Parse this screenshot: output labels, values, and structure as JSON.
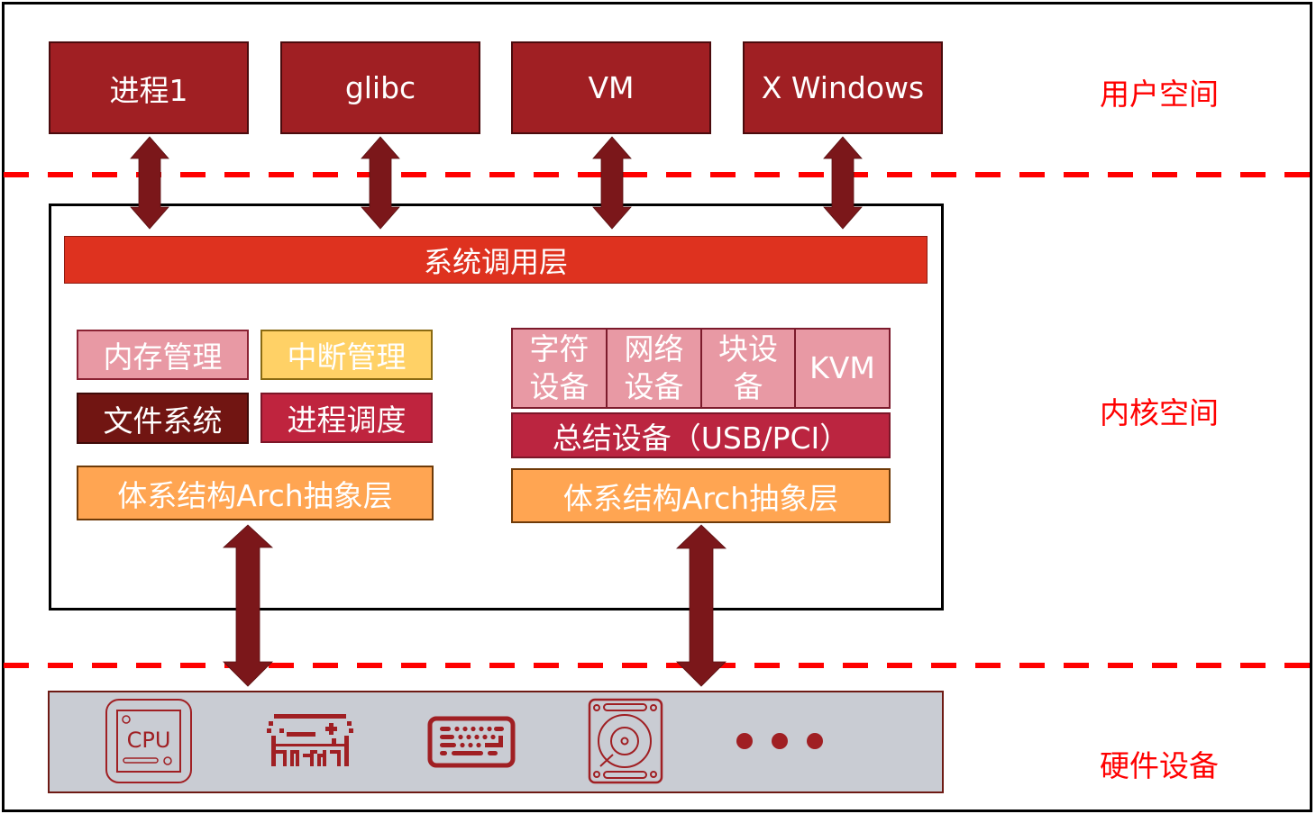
{
  "colors": {
    "user_box": "#a01f23",
    "syscall": "#de321f",
    "arrow": "#7b171a",
    "separator": "#ff0000",
    "layer_label": "#ff0000",
    "hardware_bg": "#c9ccd3",
    "icon": "#a01f23"
  },
  "user_space": {
    "label": "用户空间",
    "boxes": [
      {
        "label": "进程1"
      },
      {
        "label": "glibc"
      },
      {
        "label": "VM"
      },
      {
        "label": "X Windows"
      }
    ]
  },
  "kernel_space": {
    "label": "内核空间",
    "syscall_layer": "系统调用层",
    "left_group": {
      "modules": [
        {
          "label": "内存管理"
        },
        {
          "label": "中断管理"
        },
        {
          "label": "文件系统"
        },
        {
          "label": "进程调度"
        }
      ],
      "arch_layer": "体系结构Arch抽象层"
    },
    "right_group": {
      "devices": [
        {
          "line1": "字符",
          "line2": "设备"
        },
        {
          "line1": "网络",
          "line2": "设备"
        },
        {
          "line1": "块设",
          "line2": "备"
        },
        {
          "line1": "KVM",
          "line2": ""
        }
      ],
      "bus": "总结设备（USB/PCI）",
      "arch_layer": "体系结构Arch抽象层"
    }
  },
  "hardware": {
    "label": "硬件设备",
    "icons": [
      {
        "name": "cpu-icon",
        "text": "CPU"
      },
      {
        "name": "memory-card-icon"
      },
      {
        "name": "keyboard-icon"
      },
      {
        "name": "hard-disk-icon"
      },
      {
        "name": "more-icon"
      }
    ]
  }
}
